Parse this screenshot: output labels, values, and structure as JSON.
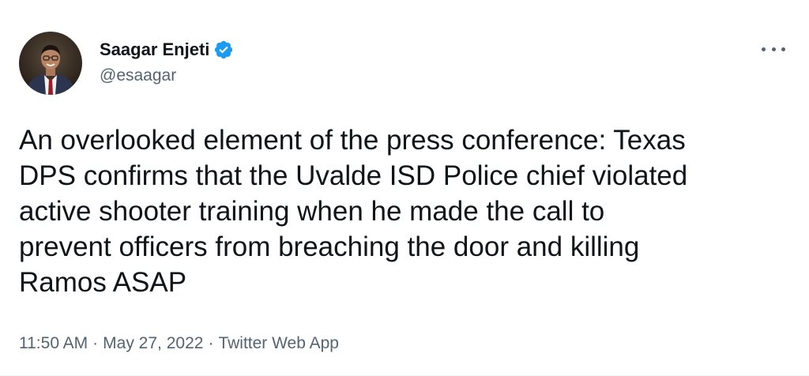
{
  "author": {
    "display_name": "Saagar Enjeti",
    "handle": "@esaagar",
    "verified": true,
    "avatar_icon": "profile-photo"
  },
  "tweet": {
    "text": "An overlooked element of the press conference: Texas\nDPS confirms that the Uvalde ISD Police chief violated\nactive shooter training when he made the call to\nprevent officers from breaching the door and killing\nRamos ASAP",
    "time": "11:50 AM",
    "date": "May 27, 2022",
    "source": "Twitter Web App",
    "separator": "·"
  },
  "icons": {
    "verified": "verified-badge-icon",
    "more": "more-options-icon"
  },
  "colors": {
    "text": "#0f1419",
    "secondary": "#536471",
    "verified_blue": "#1d9bf0"
  }
}
